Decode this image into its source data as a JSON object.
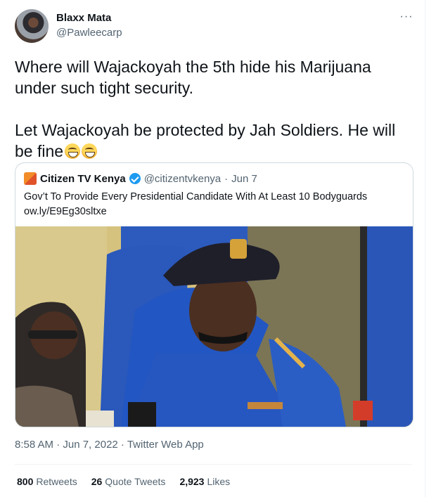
{
  "tweet": {
    "author_name": "Blaxx Mata",
    "author_handle": "@Pawleecarp",
    "more_icon": "more-horizontal-icon",
    "text_line1": "Where will Wajackoyah the 5th hide his Marijuana under such tight security.",
    "text_line2": "Let Wajackoyah be protected by Jah Soldiers. He will be fine",
    "emoji": "grinning-face-with-smiling-eyes",
    "timestamp": "8:58 AM · Jun 7, 2022 · Twitter Web App"
  },
  "quote": {
    "name": "Citizen TV Kenya",
    "handle": "@citizentvkenya",
    "separator": "·",
    "date": "Jun 7",
    "text": "Gov’t To Provide Every Presidential Candidate With At Least 10 Bodyguards",
    "link": "ow.ly/E9Eg30sltxe",
    "verified_icon": "verified-badge-icon",
    "logo_icon": "citizen-tv-logo-icon"
  },
  "stats": {
    "retweets_count": "800",
    "retweets_label": "Retweets",
    "quotes_count": "26",
    "quotes_label": "Quote Tweets",
    "likes_count": "2,923",
    "likes_label": "Likes"
  }
}
